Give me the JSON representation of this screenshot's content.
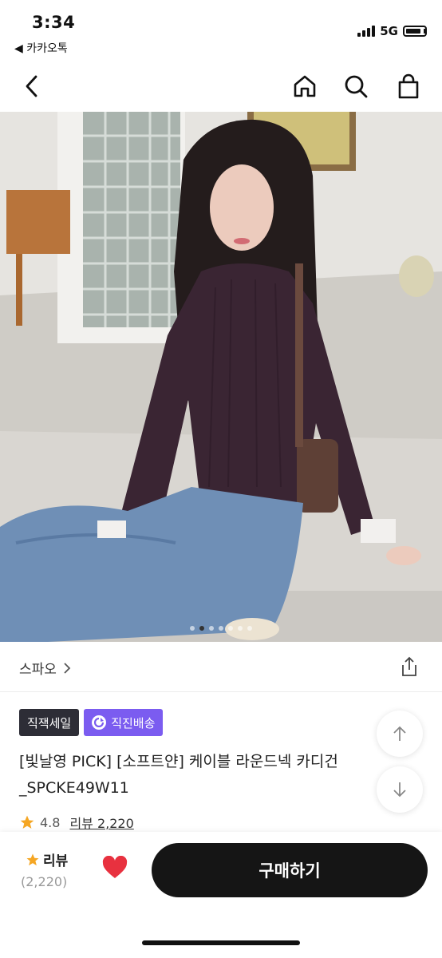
{
  "status_bar": {
    "time": "3:34",
    "back_app": "◀ 카카오톡",
    "network": "5G"
  },
  "hero": {
    "slide_count": 7,
    "active_slide": 1
  },
  "brand": {
    "name": "스파오",
    "chevron": "›"
  },
  "badges": {
    "first": "직잭세일",
    "second": "직진배송"
  },
  "product": {
    "title_line1": "[빛날영 PICK] [소프트얀] 케이블 라운드넥 카디건",
    "title_line2": "_SPCKE49W11"
  },
  "rating": {
    "score": "4.8",
    "review_link": "리뷰 2,220"
  },
  "bottom": {
    "review_label": "리뷰",
    "review_count": "(2,220)",
    "buy_label": "구매하기"
  },
  "colors": {
    "accent_purple": "#7b5cf0",
    "heart_red": "#e8313f",
    "star_orange": "#f5a623",
    "button_black": "#151515"
  },
  "icons": [
    "back-arrow-icon",
    "home-icon",
    "search-icon",
    "shopping-bag-icon",
    "chevron-right-icon",
    "share-icon",
    "truck-icon",
    "arrow-up-icon",
    "arrow-down-icon",
    "star-icon",
    "heart-icon"
  ]
}
